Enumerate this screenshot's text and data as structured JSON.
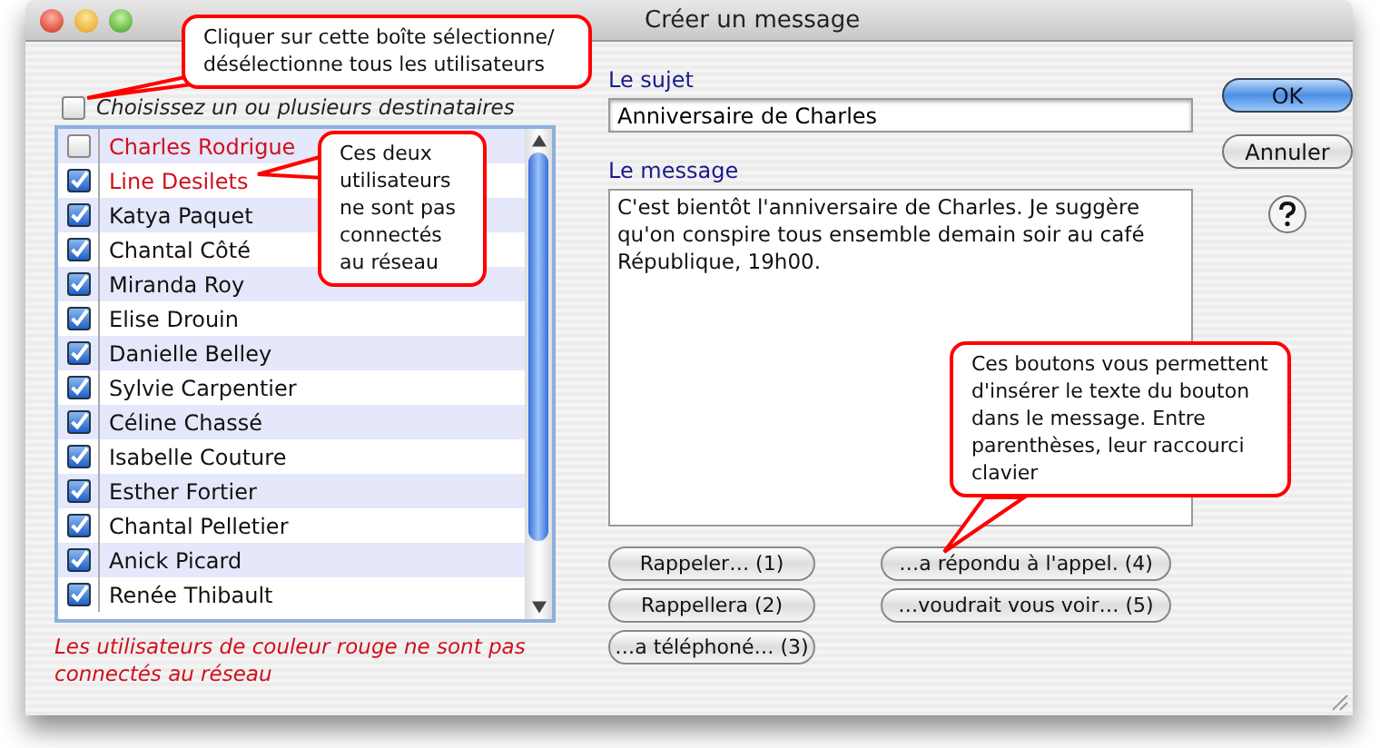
{
  "window": {
    "title": "Créer un message"
  },
  "select_all": {
    "label": "Choisissez un ou plusieurs destinataires",
    "checked": false
  },
  "recipients": [
    {
      "name": "Charles Rodrigue",
      "checked": false,
      "online": false
    },
    {
      "name": "Line Desilets",
      "checked": true,
      "online": false
    },
    {
      "name": "Katya Paquet",
      "checked": true,
      "online": true
    },
    {
      "name": "Chantal Côté",
      "checked": true,
      "online": true
    },
    {
      "name": "Miranda Roy",
      "checked": true,
      "online": true
    },
    {
      "name": "Elise Drouin",
      "checked": true,
      "online": true
    },
    {
      "name": "Danielle Belley",
      "checked": true,
      "online": true
    },
    {
      "name": "Sylvie Carpentier",
      "checked": true,
      "online": true
    },
    {
      "name": "Céline Chassé",
      "checked": true,
      "online": true
    },
    {
      "name": "Isabelle Couture",
      "checked": true,
      "online": true
    },
    {
      "name": "Esther Fortier",
      "checked": true,
      "online": true
    },
    {
      "name": "Chantal Pelletier",
      "checked": true,
      "online": true
    },
    {
      "name": "Anick Picard",
      "checked": true,
      "online": true
    },
    {
      "name": "Renée Thibault",
      "checked": true,
      "online": true
    }
  ],
  "legend": "Les utilisateurs de couleur rouge ne sont pas connectés au réseau",
  "subject": {
    "label": "Le sujet",
    "value": "Anniversaire de Charles"
  },
  "message": {
    "label": "Le message",
    "value": "C'est bientôt l'anniversaire de Charles. Je suggère qu'on conspire tous ensemble demain soir au café République, 19h00."
  },
  "insert_buttons": [
    {
      "label": "Rappeler… (1)"
    },
    {
      "label": "…a répondu à l'appel. (4)"
    },
    {
      "label": "Rappellera (2)"
    },
    {
      "label": "…voudrait vous voir… (5)"
    },
    {
      "label": "…a téléphoné… (3)"
    }
  ],
  "buttons": [
    {
      "label": "OK",
      "default": true
    },
    {
      "label": "Annuler",
      "default": false
    }
  ],
  "callouts": [
    {
      "text": "Cliquer sur cette boîte sélectionne/ désélectionne tous les utilisateurs"
    },
    {
      "text": "Ces deux utilisateurs ne sont pas connectés au réseau"
    },
    {
      "text": "Ces boutons vous permettent d'insérer le texte du bouton dans le message. Entre parenthèses, leur raccourci clavier"
    }
  ]
}
